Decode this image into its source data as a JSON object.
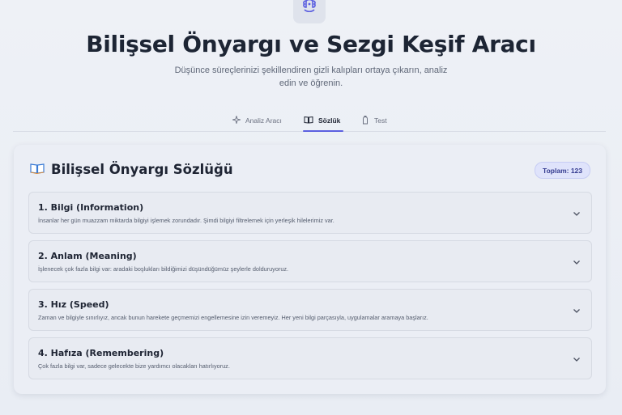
{
  "header": {
    "logo_icon": "brain-icon",
    "title": "Bilişsel Önyargı ve Sezgi Keşif Aracı",
    "subtitle": "Düşünce süreçlerinizi şekillendiren gizli kalıpları ortaya çıkarın, analiz edin ve öğrenin."
  },
  "tabs": [
    {
      "label": "Analiz Aracı",
      "icon": "sparkle-icon",
      "active": false
    },
    {
      "label": "Sözlük",
      "icon": "book-icon",
      "active": true
    },
    {
      "label": "Test",
      "icon": "hand-icon",
      "active": false
    }
  ],
  "dictionary": {
    "title_icon": "book-emoji-icon",
    "title": "Bilişsel Önyargı Sözlüğü",
    "total_badge": "Toplam: 123",
    "items": [
      {
        "title": "1. Bilgi (Information)",
        "description": "İnsanlar her gün muazzam miktarda bilgiyi işlemek zorundadır. Şimdi bilgiyi filtrelemek için yerleşik hilelerimiz var."
      },
      {
        "title": "2. Anlam (Meaning)",
        "description": "İşlenecek çok fazla bilgi var: aradaki boşlukları bildiğimizi düşündüğümüz şeylerle dolduruyoruz."
      },
      {
        "title": "3. Hız (Speed)",
        "description": "Zaman ve bilgiyle sınırlıyız, ancak bunun harekete geçmemizi engellemesine izin veremeyiz. Her yeni bilgi parçasıyla, uygulamalar aramaya başlarız."
      },
      {
        "title": "4. Hafıza (Remembering)",
        "description": "Çok fazla bilgi var, sadece gelecekte bize yardımcı olacakları hatırlıyoruz."
      }
    ]
  },
  "colors": {
    "accent": "#5b5fe0",
    "badge_bg": "#dfe3fb",
    "badge_text": "#333a8f"
  }
}
